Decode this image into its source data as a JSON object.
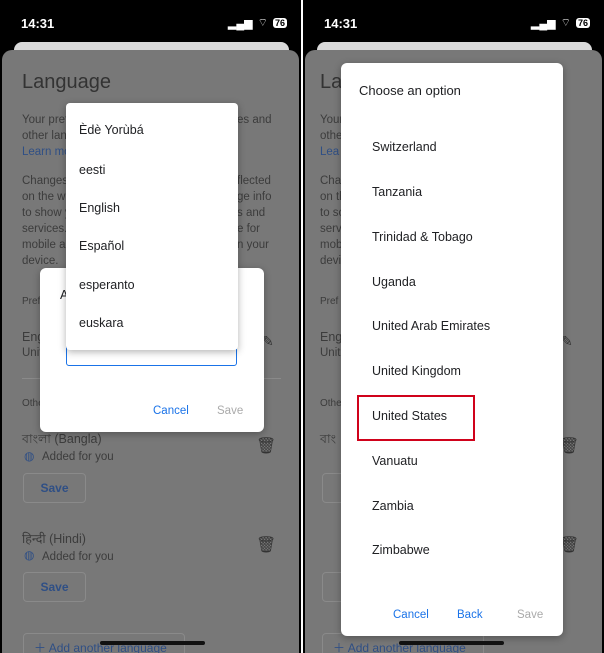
{
  "status": {
    "time": "14:31",
    "battery": "76"
  },
  "left": {
    "background": {
      "title": "Language",
      "frag": [
        "Your pref",
        "es and",
        "other lan",
        "Learn mo",
        "Changes",
        "flected",
        "on the w",
        "ge info",
        "to show y",
        "s and",
        "services.",
        "e for",
        "mobile a",
        "n your",
        "device.",
        "Pref",
        "Eng",
        "Unit",
        "Othe"
      ],
      "languages": [
        {
          "name": "বাংলা (Bangla)",
          "note": "Added for you",
          "save": "Save"
        },
        {
          "name": "हिन्दी (Hindi)",
          "note": "Added for you",
          "save": "Save"
        }
      ],
      "add_language": "Add another language"
    },
    "dialog": {
      "title_fragment": "A",
      "cancel": "Cancel",
      "save": "Save"
    },
    "dropdown": [
      "Èdè Yorùbá",
      "eesti",
      "English",
      "Español",
      "esperanto",
      "euskara"
    ]
  },
  "right": {
    "background": {
      "frag": [
        "Lang",
        "Your",
        "other",
        "Lea",
        "Cha",
        "on th",
        "to so",
        "servi",
        "mob",
        "devi",
        "Pref",
        "Eng",
        "Unit",
        "Othe",
        "বাং",
        "Add another language"
      ]
    },
    "dialog": {
      "title": "Choose an option",
      "options": [
        "Switzerland",
        "Tanzania",
        "Trinidad & Tobago",
        "Uganda",
        "United Arab Emirates",
        "United Kingdom",
        "United States",
        "Vanuatu",
        "Zambia",
        "Zimbabwe"
      ],
      "highlighted": "United States",
      "highlight_color": "#d0021b",
      "cancel": "Cancel",
      "back": "Back",
      "save": "Save"
    }
  }
}
